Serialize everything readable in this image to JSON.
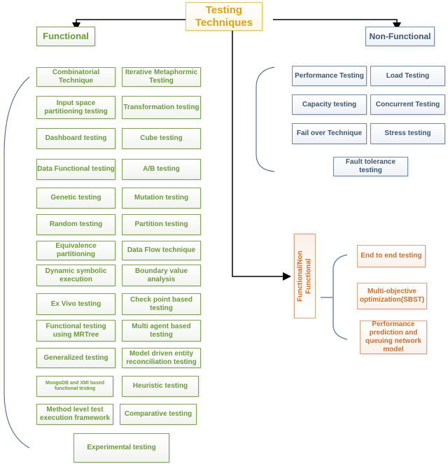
{
  "root": {
    "label": "Testing Techniques"
  },
  "functional": {
    "label": "Functional",
    "color": "#6a9a3c",
    "items": [
      "Combinatorial Technique",
      "Iterative Metaphormic Testing",
      "Input space partitioning testing",
      "Transformation testing",
      "Dashboard testing",
      "Cube testing",
      "Data Functional testing",
      "A/B testing",
      "Genetic testing",
      "Mutation testing",
      "Random testing",
      "Partition testing",
      "Equivalence partitioning",
      "Data Flow technique",
      "Dynamic symbolic execution",
      "Boundary value analysis",
      "Ex  Vivo testing",
      "Check point based testing",
      "Functional testing using MRTree",
      "Multi agent based testing",
      "Generalized testing",
      "Model driven entity reconciliation testing",
      "MongoDB and XMl based functional testing",
      "Heuristic testing",
      "Method level test execution framework",
      "Comparative testing",
      "Experimental testing"
    ]
  },
  "non_functional": {
    "label": "Non-Functional",
    "color": "#3e5674",
    "items": [
      "Performance Testing",
      "Load Testing",
      "Capacity testing",
      "Concurrent Testing",
      "Fail over Technique",
      "Stress testing",
      "Fault tolerance testing"
    ]
  },
  "hybrid": {
    "label": "Functional/Non Functional",
    "color": "#c96f2f",
    "items": [
      "End to end testing",
      "Multi-objective optimization(SBST)",
      "Performance prediction and queuing network model"
    ]
  }
}
